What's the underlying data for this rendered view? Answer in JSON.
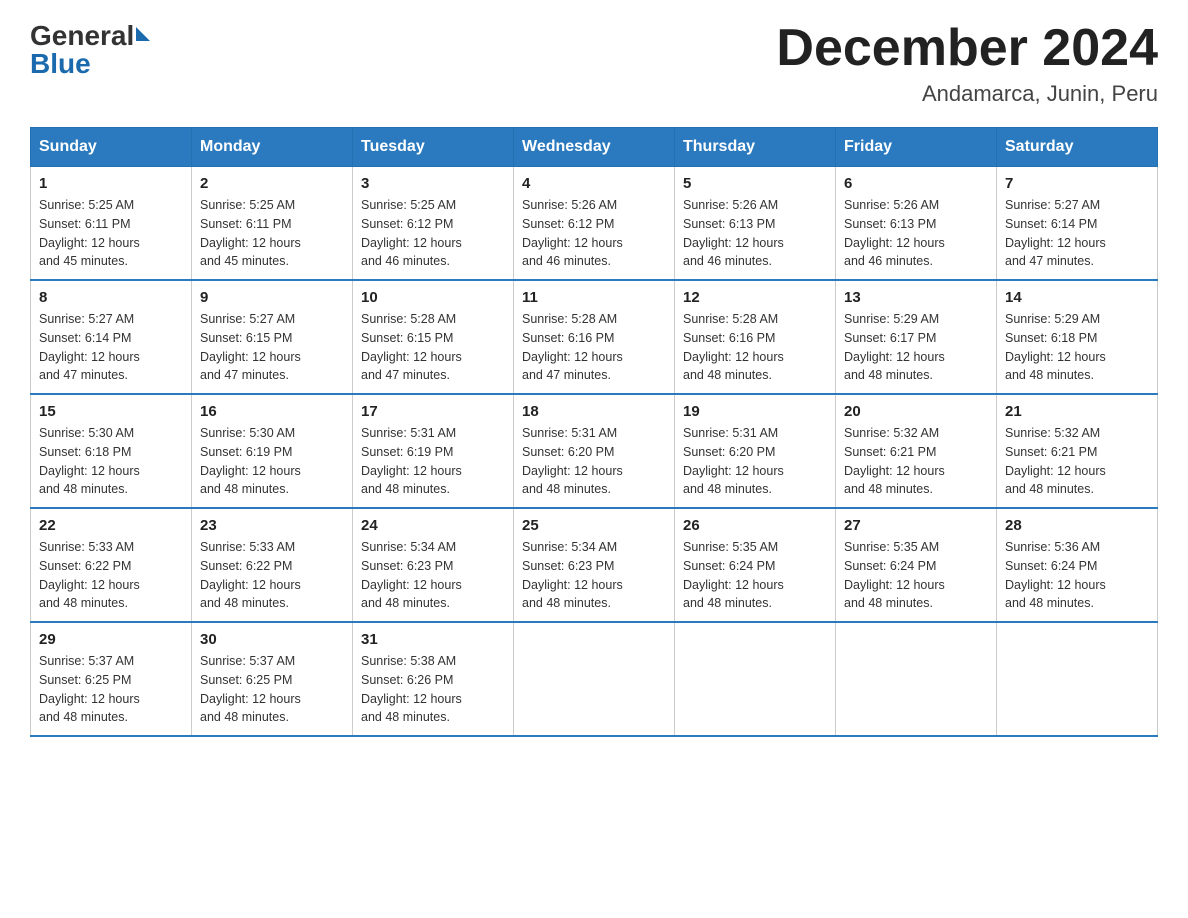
{
  "header": {
    "logo_general": "General",
    "logo_blue": "Blue",
    "month_title": "December 2024",
    "location": "Andamarca, Junin, Peru"
  },
  "days_of_week": [
    "Sunday",
    "Monday",
    "Tuesday",
    "Wednesday",
    "Thursday",
    "Friday",
    "Saturday"
  ],
  "weeks": [
    [
      {
        "day": "1",
        "sunrise": "5:25 AM",
        "sunset": "6:11 PM",
        "daylight": "12 hours and 45 minutes."
      },
      {
        "day": "2",
        "sunrise": "5:25 AM",
        "sunset": "6:11 PM",
        "daylight": "12 hours and 45 minutes."
      },
      {
        "day": "3",
        "sunrise": "5:25 AM",
        "sunset": "6:12 PM",
        "daylight": "12 hours and 46 minutes."
      },
      {
        "day": "4",
        "sunrise": "5:26 AM",
        "sunset": "6:12 PM",
        "daylight": "12 hours and 46 minutes."
      },
      {
        "day": "5",
        "sunrise": "5:26 AM",
        "sunset": "6:13 PM",
        "daylight": "12 hours and 46 minutes."
      },
      {
        "day": "6",
        "sunrise": "5:26 AM",
        "sunset": "6:13 PM",
        "daylight": "12 hours and 46 minutes."
      },
      {
        "day": "7",
        "sunrise": "5:27 AM",
        "sunset": "6:14 PM",
        "daylight": "12 hours and 47 minutes."
      }
    ],
    [
      {
        "day": "8",
        "sunrise": "5:27 AM",
        "sunset": "6:14 PM",
        "daylight": "12 hours and 47 minutes."
      },
      {
        "day": "9",
        "sunrise": "5:27 AM",
        "sunset": "6:15 PM",
        "daylight": "12 hours and 47 minutes."
      },
      {
        "day": "10",
        "sunrise": "5:28 AM",
        "sunset": "6:15 PM",
        "daylight": "12 hours and 47 minutes."
      },
      {
        "day": "11",
        "sunrise": "5:28 AM",
        "sunset": "6:16 PM",
        "daylight": "12 hours and 47 minutes."
      },
      {
        "day": "12",
        "sunrise": "5:28 AM",
        "sunset": "6:16 PM",
        "daylight": "12 hours and 48 minutes."
      },
      {
        "day": "13",
        "sunrise": "5:29 AM",
        "sunset": "6:17 PM",
        "daylight": "12 hours and 48 minutes."
      },
      {
        "day": "14",
        "sunrise": "5:29 AM",
        "sunset": "6:18 PM",
        "daylight": "12 hours and 48 minutes."
      }
    ],
    [
      {
        "day": "15",
        "sunrise": "5:30 AM",
        "sunset": "6:18 PM",
        "daylight": "12 hours and 48 minutes."
      },
      {
        "day": "16",
        "sunrise": "5:30 AM",
        "sunset": "6:19 PM",
        "daylight": "12 hours and 48 minutes."
      },
      {
        "day": "17",
        "sunrise": "5:31 AM",
        "sunset": "6:19 PM",
        "daylight": "12 hours and 48 minutes."
      },
      {
        "day": "18",
        "sunrise": "5:31 AM",
        "sunset": "6:20 PM",
        "daylight": "12 hours and 48 minutes."
      },
      {
        "day": "19",
        "sunrise": "5:31 AM",
        "sunset": "6:20 PM",
        "daylight": "12 hours and 48 minutes."
      },
      {
        "day": "20",
        "sunrise": "5:32 AM",
        "sunset": "6:21 PM",
        "daylight": "12 hours and 48 minutes."
      },
      {
        "day": "21",
        "sunrise": "5:32 AM",
        "sunset": "6:21 PM",
        "daylight": "12 hours and 48 minutes."
      }
    ],
    [
      {
        "day": "22",
        "sunrise": "5:33 AM",
        "sunset": "6:22 PM",
        "daylight": "12 hours and 48 minutes."
      },
      {
        "day": "23",
        "sunrise": "5:33 AM",
        "sunset": "6:22 PM",
        "daylight": "12 hours and 48 minutes."
      },
      {
        "day": "24",
        "sunrise": "5:34 AM",
        "sunset": "6:23 PM",
        "daylight": "12 hours and 48 minutes."
      },
      {
        "day": "25",
        "sunrise": "5:34 AM",
        "sunset": "6:23 PM",
        "daylight": "12 hours and 48 minutes."
      },
      {
        "day": "26",
        "sunrise": "5:35 AM",
        "sunset": "6:24 PM",
        "daylight": "12 hours and 48 minutes."
      },
      {
        "day": "27",
        "sunrise": "5:35 AM",
        "sunset": "6:24 PM",
        "daylight": "12 hours and 48 minutes."
      },
      {
        "day": "28",
        "sunrise": "5:36 AM",
        "sunset": "6:24 PM",
        "daylight": "12 hours and 48 minutes."
      }
    ],
    [
      {
        "day": "29",
        "sunrise": "5:37 AM",
        "sunset": "6:25 PM",
        "daylight": "12 hours and 48 minutes."
      },
      {
        "day": "30",
        "sunrise": "5:37 AM",
        "sunset": "6:25 PM",
        "daylight": "12 hours and 48 minutes."
      },
      {
        "day": "31",
        "sunrise": "5:38 AM",
        "sunset": "6:26 PM",
        "daylight": "12 hours and 48 minutes."
      },
      null,
      null,
      null,
      null
    ]
  ],
  "labels": {
    "sunrise": "Sunrise:",
    "sunset": "Sunset:",
    "daylight": "Daylight:"
  }
}
